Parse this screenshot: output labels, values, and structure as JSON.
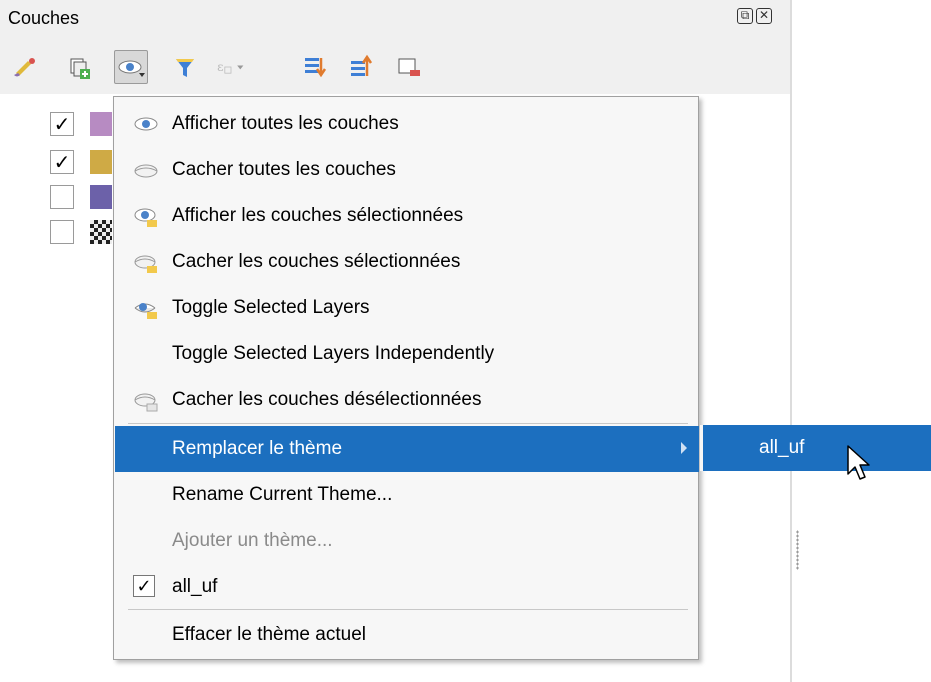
{
  "panel": {
    "title": "Couches",
    "title_buttons": [
      "float-icon",
      "close-icon"
    ]
  },
  "toolbar": {
    "tools": [
      "style-manager-icon",
      "add-group-icon",
      "visibility-themes-icon",
      "filter-legend-icon",
      "filter-expression-icon",
      "expand-all-icon",
      "collapse-all-icon",
      "remove-layer-icon"
    ]
  },
  "layers": [
    {
      "checked": true,
      "swatch": "#b78bc2"
    },
    {
      "checked": true,
      "swatch": "#cfaa45"
    },
    {
      "checked": false,
      "swatch": "#6c61a9"
    },
    {
      "checked": false,
      "swatch": "raster"
    }
  ],
  "menu": {
    "items": [
      {
        "label": "Afficher toutes les couches",
        "icon": "eye-icon"
      },
      {
        "label": "Cacher toutes les couches",
        "icon": "eye-closed-icon"
      },
      {
        "label": "Afficher les couches sélectionnées",
        "icon": "eye-selected-icon"
      },
      {
        "label": "Cacher les couches sélectionnées",
        "icon": "eye-closed-selected-icon"
      },
      {
        "label": "Toggle Selected Layers",
        "icon": "toggle-layers-icon"
      },
      {
        "label": "Toggle Selected Layers Independently",
        "icon": ""
      },
      {
        "label": "Cacher les couches désélectionnées",
        "icon": "eye-closed-deselected-icon"
      },
      {
        "label": "Remplacer le thème",
        "highlighted": true,
        "submenu": true
      },
      {
        "label": "Rename Current Theme..."
      },
      {
        "label": "Ajouter un thème...",
        "disabled": true
      },
      {
        "label": "all_uf",
        "checked": true
      },
      {
        "label": "Effacer le thème actuel"
      }
    ]
  },
  "submenu": {
    "items": [
      {
        "label": "all_uf",
        "highlighted": true
      }
    ]
  },
  "colors": {
    "highlight": "#1c6fbf",
    "menu_bg": "#f7f7f7",
    "panel_bg": "#f0f0f0"
  }
}
